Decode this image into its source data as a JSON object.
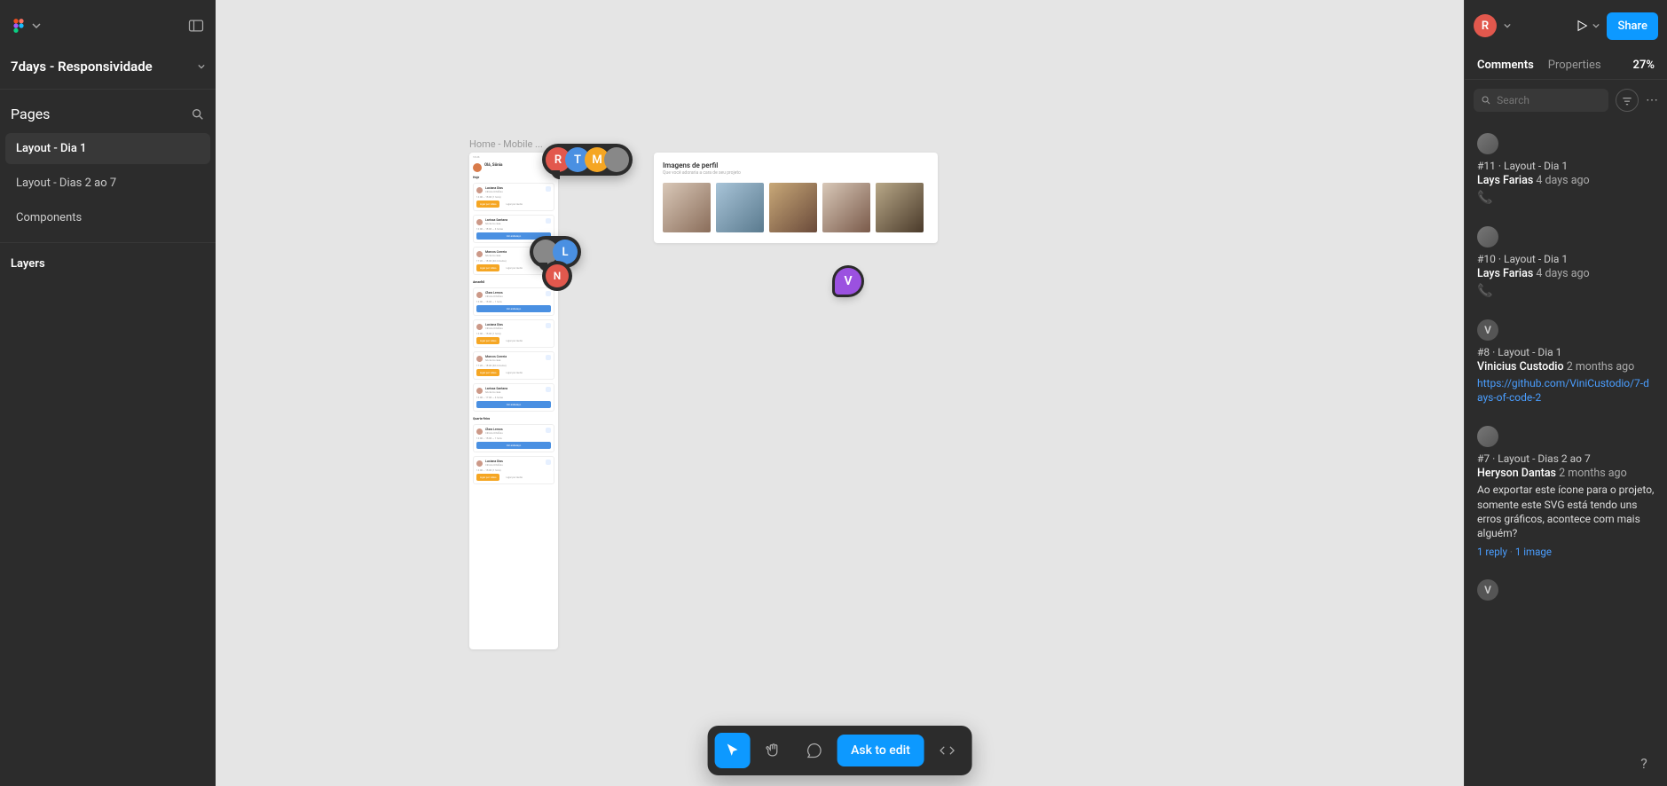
{
  "file_title": "7days - Responsividade",
  "pages_label": "Pages",
  "pages": [
    {
      "name": "Layout - Dia 1",
      "active": true
    },
    {
      "name": "Layout - Dias 2 ao 7",
      "active": false
    },
    {
      "name": "Components",
      "active": false
    }
  ],
  "layers_label": "Layers",
  "canvas": {
    "frame_label": "Home - Mobile ...",
    "greeting": "Olá, Sônia",
    "sections": {
      "today": "Hoje",
      "tomorrow": "Amanhã",
      "wednesday": "Quarta-feira"
    },
    "people": {
      "luciana": "Luciana Dias",
      "larissa": "Larissa Santana",
      "marcos": "Marcos Correia",
      "clara": "Clara Lemos"
    },
    "btn_video": "Ligar por vídeo",
    "btn_audio": "Ligar por áudio",
    "btn_address": "Ver endereço",
    "profile_card": {
      "title": "Imagens de perfil",
      "subtitle": "Que você adoraria a cara de seu projeto"
    },
    "pins": {
      "cluster1": [
        "R",
        "T",
        "M"
      ],
      "cluster2": [
        "L",
        "N"
      ],
      "single": "V"
    }
  },
  "toolbar": {
    "ask": "Ask to edit"
  },
  "right": {
    "user_initial": "R",
    "share": "Share",
    "tabs": {
      "comments": "Comments",
      "properties": "Properties"
    },
    "zoom": "27%",
    "search_placeholder": "Search"
  },
  "comments": [
    {
      "id": "#11",
      "page": "Layout - Dia 1",
      "author": "Lays Farias",
      "time": "4 days ago",
      "emoji": "📞",
      "avatar_type": "photo"
    },
    {
      "id": "#10",
      "page": "Layout - Dia 1",
      "author": "Lays Farias",
      "time": "4 days ago",
      "emoji": "📞",
      "avatar_type": "photo"
    },
    {
      "id": "#8",
      "page": "Layout - Dia 1",
      "author": "Vinicius Custodio",
      "time": "2 months ago",
      "link": "https://github.com/ViniCustodio/7-days-of-code-2",
      "avatar_type": "letter",
      "avatar_letter": "V"
    },
    {
      "id": "#7",
      "page": "Layout - Dias 2 ao 7",
      "author": "Heryson Dantas",
      "time": "2 months ago",
      "body": "Ao exportar este ícone para o projeto, somente este SVG está tendo uns erros gráficos, acontece com mais alguém?",
      "replies": "1 reply",
      "images": "1 image",
      "avatar_type": "photo"
    },
    {
      "id": "",
      "avatar_type": "letter",
      "avatar_letter": "V",
      "stub": true
    }
  ]
}
